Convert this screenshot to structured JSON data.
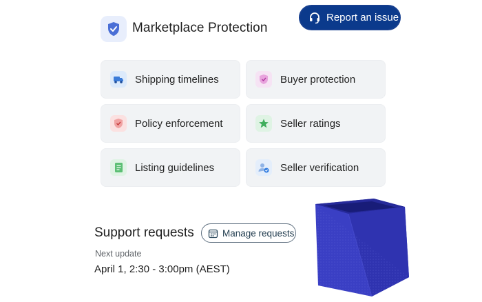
{
  "header": {
    "title": "Marketplace Protection",
    "report_button": "Report an issue"
  },
  "features": [
    {
      "label": "Shipping timelines",
      "icon": "truck-icon"
    },
    {
      "label": "Buyer protection",
      "icon": "shield-check-icon"
    },
    {
      "label": "Policy enforcement",
      "icon": "shield-alert-icon"
    },
    {
      "label": "Seller ratings",
      "icon": "star-icon"
    },
    {
      "label": "Listing guidelines",
      "icon": "document-icon"
    },
    {
      "label": "Seller verification",
      "icon": "user-verified-icon"
    }
  ],
  "support": {
    "title": "Support requests",
    "manage_button": "Manage requests",
    "next_update_label": "Next update",
    "next_update_time": "April 1, 2:30 - 3:00pm (AEST)"
  },
  "colors": {
    "accent": "#0b3a8c",
    "card_bg": "#f1f3f5",
    "box": "#3a3fc4"
  }
}
